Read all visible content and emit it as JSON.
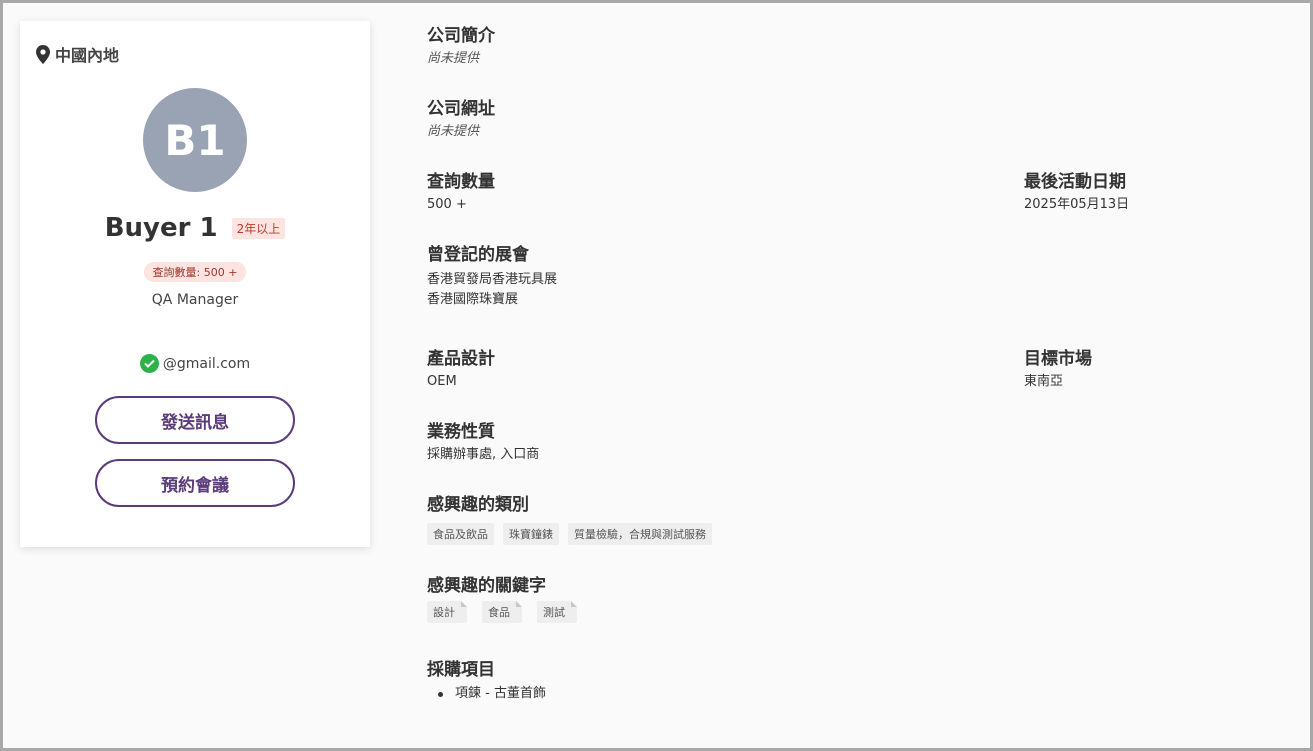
{
  "profile": {
    "location": "中國內地",
    "avatar_initials": "B1",
    "name": "Buyer 1",
    "years_badge": "2年以上",
    "inquiry_badge": "查詢數量: 500 +",
    "job_title": "QA Manager",
    "email": "@gmail.com",
    "send_message_label": "發送訊息",
    "book_meeting_label": "預約會議"
  },
  "details": {
    "company_intro": {
      "label": "公司簡介",
      "value": "尚未提供"
    },
    "company_website": {
      "label": "公司網址",
      "value": "尚未提供"
    },
    "inquiry_count": {
      "label": "查詢數量",
      "value": "500 +"
    },
    "last_active": {
      "label": "最後活動日期",
      "value": "2025年05月13日"
    },
    "registered_fairs": {
      "label": "曾登記的展會",
      "values": [
        "香港貿發局香港玩具展",
        "香港國際珠寶展"
      ]
    },
    "product_design": {
      "label": "產品設計",
      "value": "OEM"
    },
    "target_market": {
      "label": "目標市場",
      "value": "東南亞"
    },
    "business_nature": {
      "label": "業務性質",
      "value": "採購辦事處, 入口商"
    },
    "interested_categories": {
      "label": "感興趣的類別",
      "tags": [
        "食品及飲品",
        "珠寶鐘錶",
        "質量檢驗，合規與測試服務"
      ]
    },
    "interested_keywords": {
      "label": "感興趣的關鍵字",
      "tags": [
        "設計",
        "食品",
        "測試"
      ]
    },
    "purchase_items": {
      "label": "採購項目",
      "items": [
        "項鍊 - 古董首飾"
      ]
    }
  },
  "colors": {
    "accent": "#5b3c7a",
    "avatar_bg": "#99a3b3",
    "badge_bg": "#fde4e1",
    "verified": "#2db24a"
  }
}
